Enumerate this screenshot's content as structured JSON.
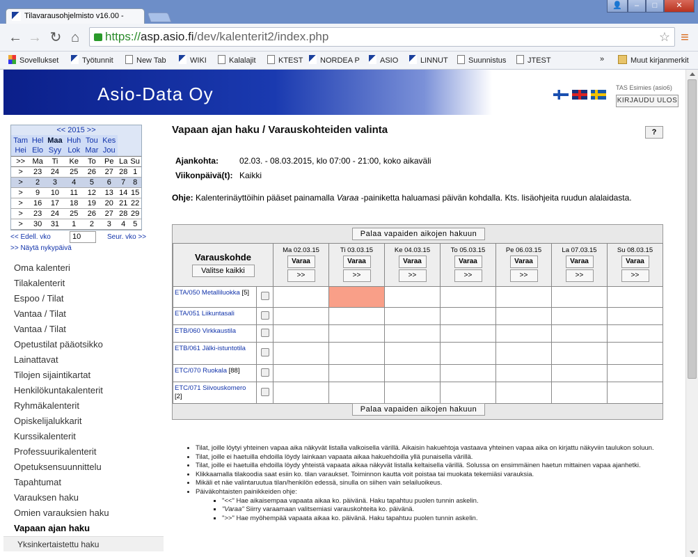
{
  "browser": {
    "tab_title": "Tilavarausohjelmisto v16.00 -",
    "url_scheme": "https://",
    "url_host": "asp.asio.fi",
    "url_path": "/dev/kalenterit2/index.php",
    "window_buttons": [
      "👤",
      "–",
      "□",
      "✕"
    ],
    "bookmarks": [
      {
        "label": "Sovellukset",
        "icon": "apps"
      },
      {
        "label": "Työtunnit",
        "icon": "bird"
      },
      {
        "label": "New Tab",
        "icon": "page"
      },
      {
        "label": "WIKI",
        "icon": "bird"
      },
      {
        "label": "Kalalajit",
        "icon": "page"
      },
      {
        "label": "KTEST",
        "icon": "page"
      },
      {
        "label": "NORDEA P",
        "icon": "bird"
      },
      {
        "label": "ASIO",
        "icon": "bird"
      },
      {
        "label": "LINNUT",
        "icon": "bird"
      },
      {
        "label": "Suunnistus",
        "icon": "page"
      },
      {
        "label": "JTEST",
        "icon": "page"
      }
    ],
    "more": "»",
    "other_bookmarks": "Muut kirjanmerkit"
  },
  "header": {
    "logo": "Asio-Data Oy",
    "user": "TAS Esimies (asio6)",
    "logout": "KIRJAUDU ULOS"
  },
  "calendar": {
    "year_nav": "<< 2015 >>",
    "months_row1": [
      "Tam",
      "Hel",
      "Maa",
      "Huh",
      "Tou",
      "Kes"
    ],
    "months_row2": [
      "Hei",
      "Elo",
      "Syy",
      "Lok",
      "Mar",
      "Jou"
    ],
    "day_headers": [
      ">>",
      "Ma",
      "Ti",
      "Ke",
      "To",
      "Pe",
      "La",
      "Su"
    ],
    "weeks": [
      [
        ">",
        "23",
        "24",
        "25",
        "26",
        "27",
        "28",
        "1"
      ],
      [
        ">",
        "2",
        "3",
        "4",
        "5",
        "6",
        "7",
        "8"
      ],
      [
        ">",
        "9",
        "10",
        "11",
        "12",
        "13",
        "14",
        "15"
      ],
      [
        ">",
        "16",
        "17",
        "18",
        "19",
        "20",
        "21",
        "22"
      ],
      [
        ">",
        "23",
        "24",
        "25",
        "26",
        "27",
        "28",
        "29"
      ],
      [
        ">",
        "30",
        "31",
        "1",
        "2",
        "3",
        "4",
        "5"
      ]
    ],
    "prev_week": "<< Edell. vko",
    "week_value": "10",
    "next_week": "Seur. vko >>",
    "show_today": ">> Näytä nykypäivä"
  },
  "nav": [
    "Oma kalenteri",
    "Tilakalenterit",
    "Espoo / Tilat",
    "Vantaa / Tilat",
    "Vantaa / Tilat",
    "Opetustilat pääotsikko",
    "Lainattavat",
    "Tilojen sijaintikartat",
    "Henkilökuntakalenterit",
    "Ryhmäkalenterit",
    "Opiskelijalukkarit",
    "Kurssikalenterit",
    "Professuurikalenterit",
    "Opetuksensuunnittelu",
    "Tapahtumat",
    "Varauksen haku",
    "Omien varauksien haku"
  ],
  "nav_active": "Vapaan ajan haku",
  "nav_sub": "Yksinkertaistettu haku",
  "main": {
    "title": "Vapaan ajan haku / Varauskohteiden valinta",
    "help": "?",
    "ajankohta_label": "Ajankohta:",
    "ajankohta_value": "02.03. - 08.03.2015, klo 07:00 - 21:00, koko aikaväli",
    "viikonpaiva_label": "Viikonpäivä(t):",
    "viikonpaiva_value": "Kaikki",
    "ohje_label": "Ohje:",
    "ohje_text_1": " Kalenterinäyttöihin pääset painamalla ",
    "ohje_em": "Varaa",
    "ohje_text_2": " -painiketta haluamasi päivän kohdalla. Kts. lisäohjeita ruudun alalaidasta.",
    "palaa": "Palaa vapaiden aikojen hakuun",
    "varauskohde": "Varauskohde",
    "valitse_kaikki": "Valitse kaikki",
    "varaa": "Varaa",
    "next": ">>",
    "days": [
      "Ma 02.03.15",
      "Ti 03.03.15",
      "Ke 04.03.15",
      "To 05.03.15",
      "Pe 06.03.15",
      "La 07.03.15",
      "Su 08.03.15"
    ],
    "rows": [
      {
        "name": "ETA/050 Metalliluokka",
        "count": "[5]",
        "red": [
          1
        ]
      },
      {
        "name": "ETA/051 Liikuntasali",
        "count": "",
        "red": []
      },
      {
        "name": "ETB/060 Virkkaustila",
        "count": "",
        "red": []
      },
      {
        "name": "ETB/061 Jälki-istuntotila",
        "count": "",
        "red": []
      },
      {
        "name": "ETC/070 Ruokala",
        "count": "[88]",
        "red": []
      },
      {
        "name": "ETC/071 Siivouskomero",
        "count": "[2]",
        "red": []
      }
    ]
  },
  "notes": {
    "items": [
      "Tilat, joille löytyi yhteinen vapaa aika näkyvät listalla valkoisella värillä. Aikaisin hakuehtoja vastaava yhteinen vapaa aika on kirjattu näkyviin taulukon soluun.",
      "Tilat, joille ei haetuilla ehdoilla löydy lainkaan vapaata aikaa hakuehdoilla yllä punaisella värillä.",
      "Tilat, joille ei haetuilla ehdoilla löydy yhteistä vapaata aikaa näkyvät listalla keltaisella värillä. Solussa on ensimmäinen haetun mittainen vapaa ajanhetki.",
      "Klikkaamalla tilakoodia saat esiin ko. tilan varaukset. Toiminnon kautta voit poistaa tai muokata tekemiäsi varauksia.",
      "Mikäli et näe valintaruutua tilan/henkilön edessä, sinulla on siihen vain selailuoikeus.",
      "Päiväkohtaisten painikkeiden ohje:"
    ],
    "sub": [
      {
        "key": "\"<<\"",
        "text": " Hae aikaisempaa vapaata aikaa ko. päivänä. Haku tapahtuu puolen tunnin askelin."
      },
      {
        "key": "\"Varaa\"",
        "text": " Siirry varaamaan valitsemiasi varauskohteita ko. päivänä."
      },
      {
        "key": "\">>\"",
        "text": " Hae myöhempää vapaata aikaa ko. päivänä. Haku tapahtuu puolen tunnin askelin."
      }
    ]
  }
}
